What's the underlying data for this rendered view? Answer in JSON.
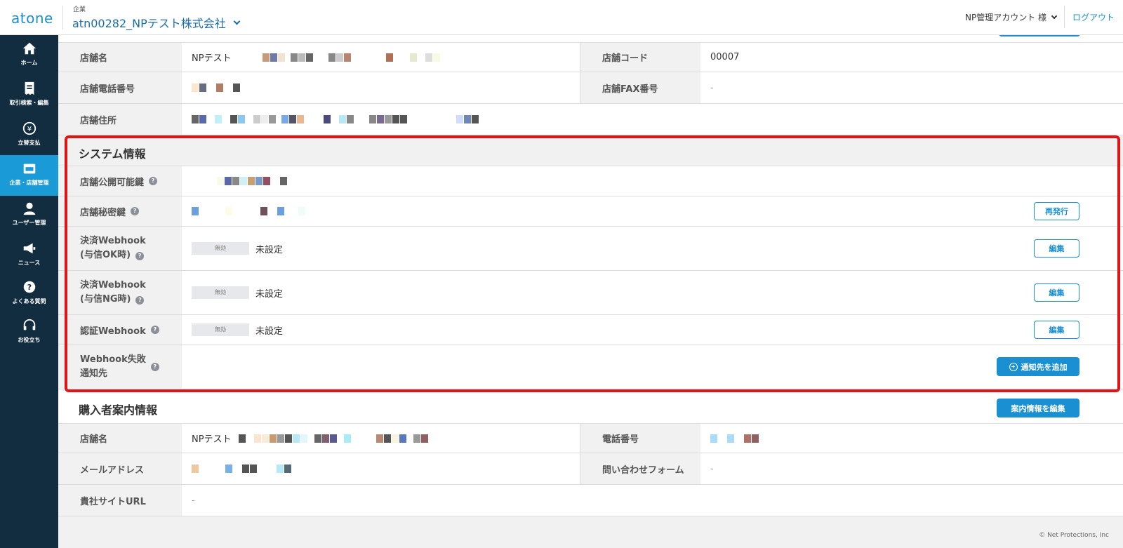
{
  "header": {
    "logo": "atone",
    "company_sub_label": "企業",
    "company_name": "atn00282_NPテスト株式会社",
    "account": "NP管理アカウント 様",
    "logout": "ログアウト"
  },
  "sidebar": {
    "items": [
      {
        "label": "ホーム",
        "icon": "home-icon"
      },
      {
        "label": "取引検索・編集",
        "icon": "receipt-icon"
      },
      {
        "label": "立替支払",
        "icon": "yen-icon"
      },
      {
        "label": "企業・店舗管理",
        "icon": "store-icon",
        "active": true
      },
      {
        "label": "ユーザー管理",
        "icon": "user-icon"
      },
      {
        "label": "ニュース",
        "icon": "megaphone-icon"
      },
      {
        "label": "よくある質問",
        "icon": "question-icon"
      },
      {
        "label": "お役立ち",
        "icon": "headset-icon"
      }
    ]
  },
  "store_info": {
    "store_name_label": "店舗名",
    "store_name_value": "NPテスト",
    "store_code_label": "店舗コード",
    "store_code_value": "00007",
    "phone_label": "店舗電話番号",
    "fax_label": "店舗FAX番号",
    "fax_value": "-",
    "address_label": "店舗住所"
  },
  "system_info": {
    "title": "システム情報",
    "public_key_label": "店舗公開可能鍵",
    "secret_key_label": "店舗秘密鍵",
    "reissue_button": "再発行",
    "webhook_ok_label_1": "決済Webhook",
    "webhook_ok_label_2": "(与信OK時)",
    "webhook_ng_label_1": "決済Webhook",
    "webhook_ng_label_2": "(与信NG時)",
    "auth_webhook_label": "認証Webhook",
    "failure_label_1": "Webhook失敗",
    "failure_label_2": "通知先",
    "disabled_badge": "無効",
    "not_set": "未設定",
    "edit_button": "編集",
    "add_notify_button": "通知先を追加",
    "help_mark": "?"
  },
  "buyer_info": {
    "title": "購入者案内情報",
    "edit_info_button": "案内情報を編集",
    "store_name_label": "店舗名",
    "store_name_value": "NPテスト",
    "phone_label": "電話番号",
    "email_label": "メールアドレス",
    "contact_form_label": "問い合わせフォーム",
    "contact_form_value": "-",
    "site_url_label": "貴社サイトURL",
    "site_url_value": "-"
  },
  "footer": {
    "copyright": "© Net Protections, Inc"
  },
  "colors": {
    "accent": "#1a8fd1",
    "sidebar_bg": "#122d40",
    "sidebar_active": "#1a9ad6",
    "highlight_frame": "#e01414"
  }
}
